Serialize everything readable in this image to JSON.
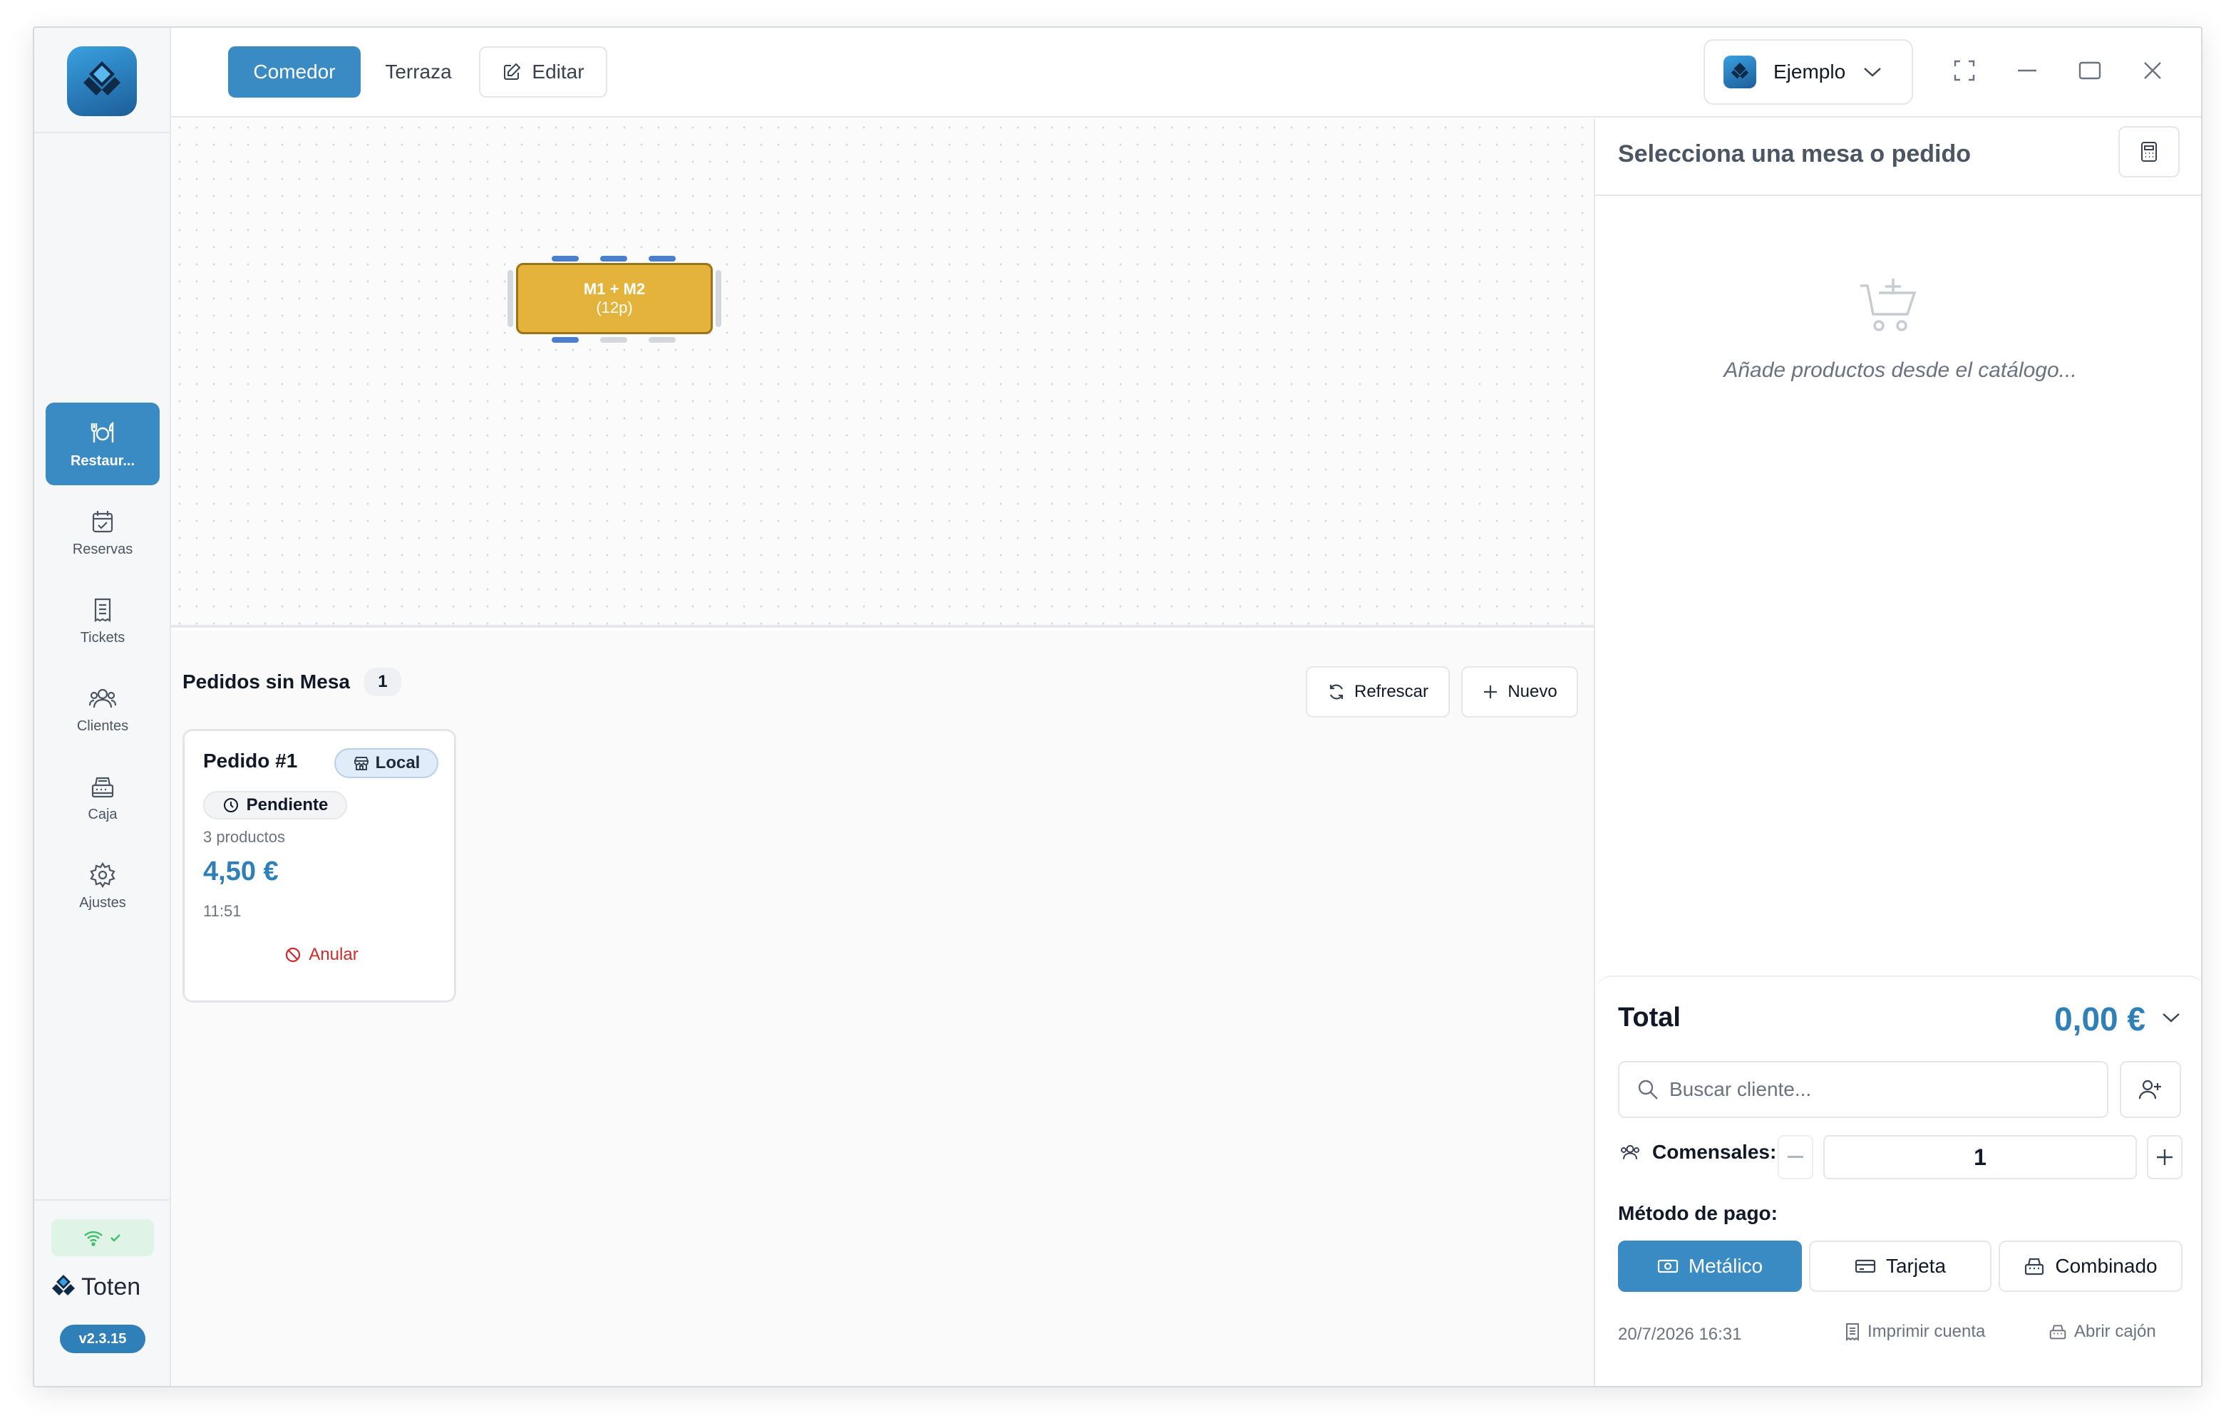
{
  "app": {
    "brand": "Toten",
    "version": "v2.3.15"
  },
  "sidebar": {
    "items": [
      {
        "label": "Restaur...",
        "icon": "utensils-icon",
        "active": true
      },
      {
        "label": "Reservas",
        "icon": "calendar-check-icon",
        "active": false
      },
      {
        "label": "Tickets",
        "icon": "receipt-icon",
        "active": false
      },
      {
        "label": "Clientes",
        "icon": "users-icon",
        "active": false
      },
      {
        "label": "Caja",
        "icon": "cash-register-icon",
        "active": false
      },
      {
        "label": "Ajustes",
        "icon": "gear-icon",
        "active": false
      }
    ]
  },
  "topbar": {
    "tabs": [
      {
        "label": "Comedor",
        "active": true
      },
      {
        "label": "Terraza",
        "active": false
      }
    ],
    "edit_label": "Editar",
    "account_name": "Ejemplo"
  },
  "floor": {
    "table": {
      "name": "M1 + M2",
      "capacity": "(12p)"
    }
  },
  "orders": {
    "title": "Pedidos sin Mesa",
    "count": "1",
    "refresh_label": "Refrescar",
    "new_label": "Nuevo",
    "cards": [
      {
        "title": "Pedido #1",
        "type": "Local",
        "status": "Pendiente",
        "products": "3 productos",
        "price": "4,50 €",
        "time": "11:51",
        "cancel": "Anular"
      }
    ]
  },
  "panel": {
    "title": "Selecciona una mesa o pedido",
    "empty_text": "Añade productos desde el catálogo...",
    "total_label": "Total",
    "total_value": "0,00 €",
    "search_placeholder": "Buscar cliente...",
    "diners_label": "Comensales:",
    "diners_value": "1",
    "payment_label": "Método de pago:",
    "payment_methods": [
      {
        "label": "Metálico",
        "active": true
      },
      {
        "label": "Tarjeta",
        "active": false
      },
      {
        "label": "Combinado",
        "active": false
      }
    ],
    "datetime": "20/7/2026 16:31",
    "print_label": "Imprimir cuenta",
    "drawer_label": "Abrir cajón"
  },
  "colors": {
    "accent": "#3a8bc4",
    "price": "#2f7fb8",
    "table": "#e3b33c",
    "danger": "#d02a2a"
  }
}
